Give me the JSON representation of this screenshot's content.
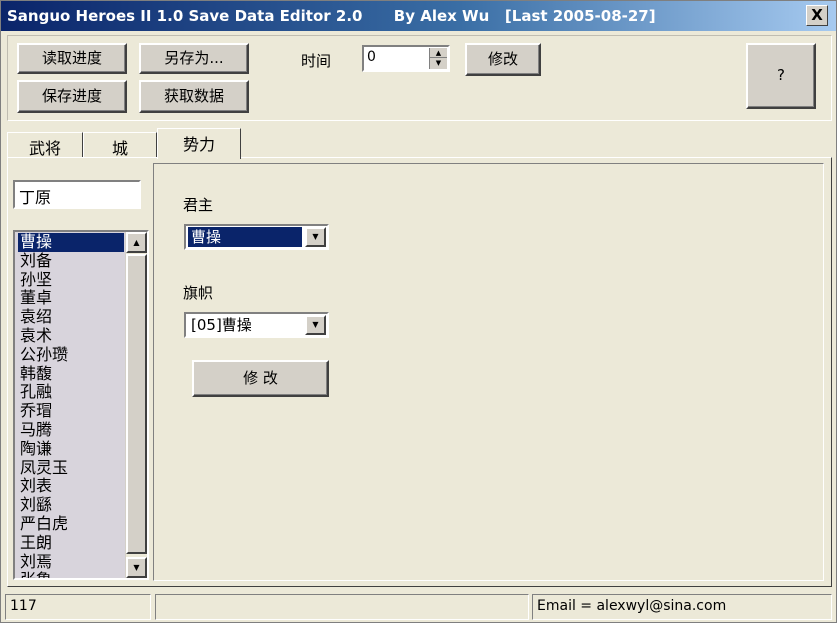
{
  "window": {
    "title": "Sanguo Heroes II 1.0 Save Data Editor 2.0      By Alex Wu   [Last 2005-08-27]",
    "close_label": "X"
  },
  "toolbar": {
    "load_label": "读取进度",
    "save_as_label": "另存为...",
    "save_label": "保存进度",
    "fetch_label": "获取数据",
    "time_label": "时间",
    "time_value": "0",
    "modify_label": "修改",
    "help_label": "?"
  },
  "tabs": [
    {
      "label": "武将"
    },
    {
      "label": "城"
    },
    {
      "label": "势力"
    }
  ],
  "left": {
    "search_value": "丁原",
    "list_items": [
      "曹操",
      "刘备",
      "孙坚",
      "董卓",
      "袁绍",
      "袁术",
      "公孙瓒",
      "韩馥",
      "孔融",
      "乔瑁",
      "马腾",
      "陶谦",
      "凤灵玉",
      "刘表",
      "刘繇",
      "严白虎",
      "王朗",
      "刘焉",
      "张鲁"
    ],
    "selected_index": 0
  },
  "faction": {
    "lord_label": "君主",
    "lord_value": "曹操",
    "banner_label": "旗帜",
    "banner_value": "[05]曹操",
    "modify_label": "修  改"
  },
  "status": {
    "count": "117",
    "middle": "",
    "email": "Email  =  alexwyl@sina.com"
  }
}
